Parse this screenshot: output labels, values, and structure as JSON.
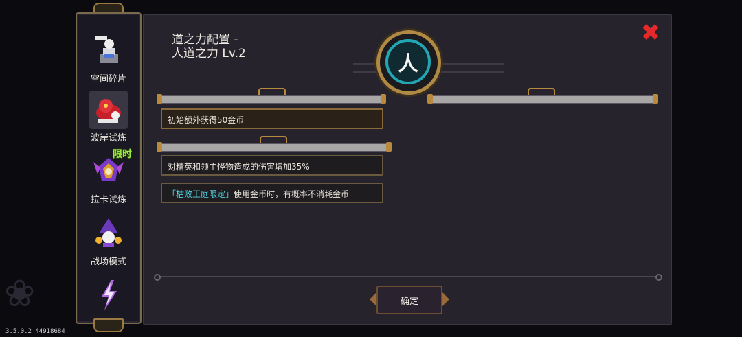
{
  "sidebar": {
    "items": [
      {
        "label": "空间碎片",
        "icon": "space-fragment-icon"
      },
      {
        "label": "波岸试炼",
        "icon": "red-creature-icon"
      },
      {
        "label": "拉卡试炼",
        "icon": "purple-crest-icon",
        "badge": "限时"
      },
      {
        "label": "战场模式",
        "icon": "purple-wizard-icon"
      },
      {
        "label": "",
        "icon": "lightning-icon"
      }
    ],
    "active_index": 1
  },
  "panel": {
    "title_line1": "道之力配置 -",
    "title_line2": "人道之力 Lv.2",
    "emblem_char": "人",
    "close_icon": "close-icon",
    "bonus_1": "初始额外获得50金币",
    "bonus_2": "对精英和领主怪物造成的伤害增加35%",
    "bonus_3_prefix": "「枯败王庭限定」",
    "bonus_3_rest": "使用金币时，有概率不消耗金币",
    "confirm_label": "确定"
  },
  "version": "3.5.0.2 44918684",
  "colors": {
    "accent_cyan": "#4fd0de",
    "close_red": "#e22a2a",
    "gold_frame": "#b08944",
    "limited_green": "#9be84a"
  }
}
